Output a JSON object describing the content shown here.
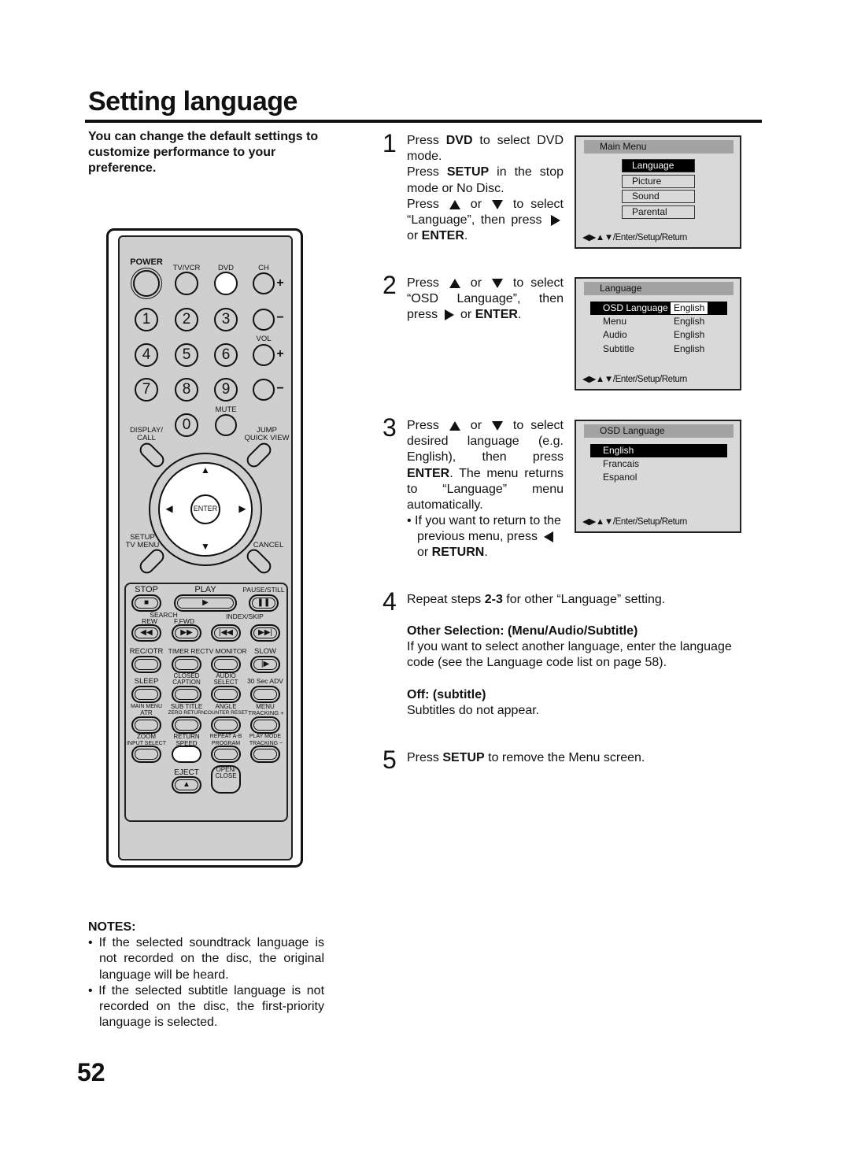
{
  "title": "Setting language",
  "intro": "You can change the default settings to customize performance to your preference.",
  "remote": {
    "power": "POWER",
    "tvvcr": "TV/VCR",
    "dvd": "DVD",
    "ch": "CH",
    "vol": "VOL",
    "mute": "MUTE",
    "digits": [
      "1",
      "2",
      "3",
      "4",
      "5",
      "6",
      "7",
      "8",
      "9",
      "0"
    ],
    "display": "DISPLAY/",
    "call": "CALL",
    "jump": "JUMP",
    "quickview": "QUICK VIEW",
    "enter": "ENTER",
    "setup": "SETUP",
    "tvmenu": "TV MENU",
    "cancel": "CANCEL",
    "stop": "STOP",
    "play": "PLAY",
    "pause": "PAUSE/STILL",
    "search": "SEARCH",
    "rew": "REW",
    "ffwd": "F.FWD",
    "indexskip": "INDEX/SKIP",
    "recotr": "REC/OTR",
    "timerrec": "TIMER REC",
    "tvmonitor": "TV MONITOR",
    "slow": "SLOW",
    "sleep": "SLEEP",
    "closed": "CLOSED",
    "caption": "CAPTION",
    "audio": "AUDIO",
    "select": "SELECT",
    "adv": "30 Sec ADV",
    "mainmenu": "MAIN MENU",
    "atr": "ATR",
    "subtitle": "SUB TITLE",
    "zeroreturn": "ZERO RETURN",
    "angle": "ANGLE",
    "counterreset": "COUNTER RESET",
    "menu": "MENU",
    "trackingplus": "TRACKING +",
    "zoom": "ZOOM",
    "inputselect": "INPUT SELECT",
    "return": "RETURN",
    "speed": "SPEED",
    "repeatab": "REPEAT A-B",
    "program": "PROGRAM",
    "playmode": "PLAY MODE",
    "trackingminus": "TRACKING −",
    "eject": "EJECT",
    "open": "OPEN/",
    "close": "CLOSE",
    "plus": "+",
    "minus": "−"
  },
  "steps": [
    {
      "num": "1",
      "a": "Press ",
      "a_b": "DVD",
      "a2": " to select DVD mode.",
      "b": "Press ",
      "b_b": "SETUP",
      "b2": " in the stop mode or No Disc.",
      "c": "Press ",
      "c2": " or ",
      "c3": " to select “Language”, then press ",
      "c4": "or ",
      "c_b": "ENTER",
      "c5": "."
    },
    {
      "num": "2",
      "a": "Press ",
      "a2": " or ",
      "a3": " to select “OSD Language”, then press ",
      "a4": " or ",
      "a_b": "ENTER",
      "a5": "."
    },
    {
      "num": "3",
      "a": "Press ",
      "a2": " or ",
      "a3": " to select desired language (e.g. English), then press ",
      "a_b": "ENTER",
      "a4": ". The menu returns to “Language” menu automatically.",
      "bullet": "If you want to return to the previous menu, press ",
      "b2": "or ",
      "b_b": "RETURN",
      "b3": "."
    },
    {
      "num": "4",
      "a": "Repeat steps ",
      "a_b": "2-3",
      "a2": " for other “Language” setting."
    },
    {
      "num": "5",
      "a": "Press ",
      "a_b": "SETUP",
      "a2": " to remove the Menu screen."
    }
  ],
  "other": {
    "heading": "Other Selection: (Menu/Audio/Subtitle)",
    "text": "If you want to select another language, enter the language code (see the Language code list on page 58).",
    "off_heading": "Off: (subtitle)",
    "off_text": "Subtitles do not appear."
  },
  "screens": {
    "footer": "◀▶▲▼/Enter/Setup/Return",
    "main": {
      "header": "Main Menu",
      "items": [
        "Language",
        "Picture",
        "Sound",
        "Parental"
      ],
      "selected": "Language"
    },
    "language": {
      "header": "Language",
      "rows": [
        {
          "k": "OSD Language",
          "v": "English"
        },
        {
          "k": "Menu",
          "v": "English"
        },
        {
          "k": "Audio",
          "v": "English"
        },
        {
          "k": "Subtitle",
          "v": "English"
        }
      ],
      "selected": "OSD Language"
    },
    "osd": {
      "header": "OSD Language",
      "items": [
        "English",
        "Francais",
        "Espanol"
      ],
      "selected": "English"
    }
  },
  "notes": {
    "heading": "NOTES:",
    "items": [
      "If the selected soundtrack language is not recorded on the disc, the original language will be heard.",
      "If the selected subtitle language is not recorded on the disc, the first-priority language is selected."
    ]
  },
  "page_number": "52"
}
